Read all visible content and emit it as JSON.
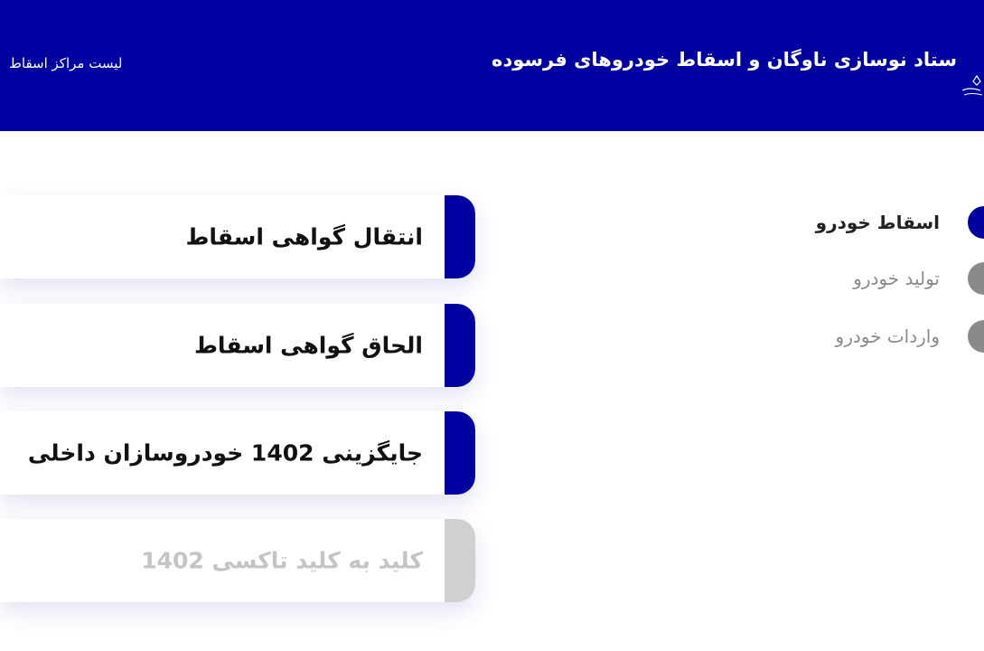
{
  "header": {
    "title": "ستاد نوسازی ناوگان و اسقاط خودروهای فرسوده",
    "centers_link": "لیست مراکز اسقاط"
  },
  "services": [
    {
      "label": "انتقال گواهی اسقاط",
      "enabled": true
    },
    {
      "label": "الحاق گواهی اسقاط",
      "enabled": true
    },
    {
      "label": "جایگزینی 1402 خودروسازان داخلی",
      "enabled": true
    },
    {
      "label": "کلید به کلید تاکسی 1402",
      "enabled": false
    }
  ],
  "categories": [
    {
      "label": "اسقاط خودرو",
      "active": true
    },
    {
      "label": "تولید خودرو",
      "active": false
    },
    {
      "label": "واردات خودرو",
      "active": false
    }
  ],
  "colors": {
    "brand": "#0000a0",
    "inactive": "#8a8a8a",
    "disabled": "#d0d0d0"
  }
}
